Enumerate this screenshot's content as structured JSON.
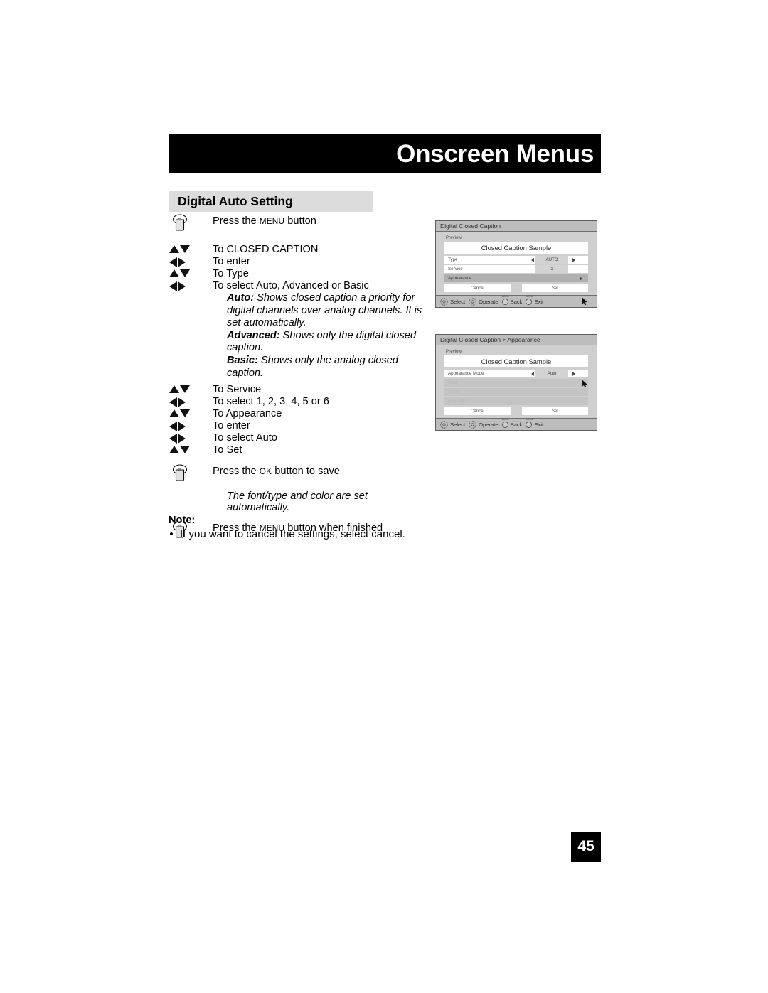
{
  "page": {
    "title": "Onscreen Menus",
    "section_title": "Digital Auto Setting",
    "number": "45"
  },
  "steps": [
    {
      "icon": "press-button-icon",
      "text_before": "Press the ",
      "smallcap": "MENU",
      "text_after": " button"
    },
    {
      "icon": "up-down-arrows-icon",
      "text": "To CLOSED CAPTION"
    },
    {
      "icon": "left-right-arrows-icon",
      "text": "To enter"
    },
    {
      "icon": "up-down-arrows-icon",
      "text": "To Type"
    },
    {
      "icon": "left-right-arrows-icon",
      "text": "To select Auto, Advanced or Basic"
    },
    {
      "icon": "up-down-arrows-icon",
      "text": "To Service"
    },
    {
      "icon": "left-right-arrows-icon",
      "text": "To select 1, 2, 3, 4, 5 or 6"
    },
    {
      "icon": "up-down-arrows-icon",
      "text": "To Appearance"
    },
    {
      "icon": "left-right-arrows-icon",
      "text": "To enter"
    },
    {
      "icon": "left-right-arrows-icon",
      "text": "To select Auto"
    },
    {
      "icon": "up-down-arrows-icon",
      "text": "To Set"
    },
    {
      "icon": "press-button-icon",
      "text_before": "Press the ",
      "smallcap": "OK",
      "text_after": " button to save"
    },
    {
      "icon": "press-button-icon",
      "text_before": "Press the ",
      "smallcap": "MENU",
      "text_after": " button when finished"
    }
  ],
  "explanations": [
    {
      "term": "Auto:",
      "body": " Shows closed caption a priority for digital channels over analog channels.  It is set automatically."
    },
    {
      "term": "Advanced:",
      "body": " Shows only the digital closed caption."
    },
    {
      "term": "Basic:",
      "body": " Shows only the analog closed caption."
    }
  ],
  "auto_note": "The font/type and color are set automatically.",
  "note": {
    "heading": "Note:",
    "bullet": "•",
    "items": [
      "If you want to cancel the settings, select cancel."
    ]
  },
  "osd_panels": [
    {
      "title": "Digital Closed Caption",
      "preview_label": "Preview",
      "sample_text": "Closed Caption Sample",
      "rows": [
        {
          "label": "Type",
          "value": "AUTO",
          "state": "normal",
          "has_arrows": true,
          "has_value_box": true,
          "has_submenu_arrow": false
        },
        {
          "label": "Service",
          "value": "1",
          "state": "normal",
          "has_arrows": false,
          "has_value_box": true,
          "has_submenu_arrow": false
        },
        {
          "label": "Appearance",
          "value": "",
          "state": "selected",
          "has_arrows": false,
          "has_value_box": false,
          "has_submenu_arrow": true
        }
      ],
      "buttons": [
        "Cancel",
        "Set"
      ],
      "footer": [
        {
          "label": "Select",
          "icon": "dpad-icon",
          "cap": ""
        },
        {
          "label": "Operate",
          "icon": "dpad-icon",
          "cap": ""
        },
        {
          "label": "Back",
          "icon": "circle-icon",
          "cap": "BACK"
        },
        {
          "label": "Exit",
          "icon": "circle-icon",
          "cap": "MENU"
        }
      ]
    },
    {
      "title": "Digital Closed Caption  >  Appearance",
      "preview_label": "Preview",
      "sample_text": "Closed Caption Sample",
      "rows": [
        {
          "label": "Appearance Mode",
          "value": "Auto",
          "state": "normal",
          "has_arrows": true,
          "has_value_box": true,
          "has_submenu_arrow": false
        },
        {
          "label": "Font",
          "value": "",
          "state": "dim",
          "has_arrows": false,
          "has_value_box": false,
          "has_submenu_arrow": false
        },
        {
          "label": "Colors",
          "value": "",
          "state": "dim",
          "has_arrows": false,
          "has_value_box": false,
          "has_submenu_arrow": false
        },
        {
          "label": "Opacities",
          "value": "",
          "state": "dim",
          "has_arrows": false,
          "has_value_box": false,
          "has_submenu_arrow": false
        }
      ],
      "buttons": [
        "Cancel",
        "Set"
      ],
      "footer": [
        {
          "label": "Select",
          "icon": "dpad-icon",
          "cap": ""
        },
        {
          "label": "Operate",
          "icon": "dpad-icon",
          "cap": ""
        },
        {
          "label": "Back",
          "icon": "circle-icon",
          "cap": "BACK"
        },
        {
          "label": "Exit",
          "icon": "circle-icon",
          "cap": "MENU"
        }
      ]
    }
  ],
  "colors": {
    "title_bar": "#000000",
    "section_bar": "#dcdcdc",
    "osd_body": "#cfcfcf",
    "osd_chrome": "#bdbdbd",
    "osd_selected": "#b0b0b0"
  }
}
